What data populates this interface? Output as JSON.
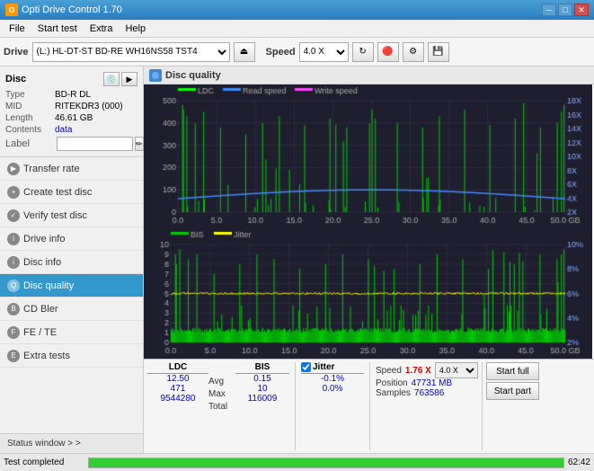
{
  "app": {
    "title": "Opti Drive Control 1.70",
    "icon": "O"
  },
  "titlebar": {
    "minimize": "─",
    "maximize": "□",
    "close": "✕"
  },
  "menubar": {
    "items": [
      "File",
      "Start test",
      "Extra",
      "Help"
    ]
  },
  "toolbar": {
    "drive_label": "Drive",
    "drive_value": "(L:)  HL-DT-ST BD-RE  WH16NS58 TST4",
    "speed_label": "Speed",
    "speed_value": "4.0 X"
  },
  "disc": {
    "title": "Disc",
    "type_label": "Type",
    "type_value": "BD-R DL",
    "mid_label": "MID",
    "mid_value": "RITEKDR3 (000)",
    "length_label": "Length",
    "length_value": "46.61 GB",
    "contents_label": "Contents",
    "contents_value": "data",
    "label_label": "Label",
    "label_value": ""
  },
  "nav": {
    "items": [
      {
        "id": "transfer-rate",
        "label": "Transfer rate",
        "active": false
      },
      {
        "id": "create-test-disc",
        "label": "Create test disc",
        "active": false
      },
      {
        "id": "verify-test-disc",
        "label": "Verify test disc",
        "active": false
      },
      {
        "id": "drive-info",
        "label": "Drive info",
        "active": false
      },
      {
        "id": "disc-info",
        "label": "Disc info",
        "active": false
      },
      {
        "id": "disc-quality",
        "label": "Disc quality",
        "active": true
      },
      {
        "id": "cd-bler",
        "label": "CD Bler",
        "active": false
      },
      {
        "id": "fe-te",
        "label": "FE / TE",
        "active": false
      },
      {
        "id": "extra-tests",
        "label": "Extra tests",
        "active": false
      }
    ]
  },
  "status_window": {
    "label": "Status window > >"
  },
  "panel": {
    "title": "Disc quality"
  },
  "chart_top": {
    "legend": {
      "ldc": "LDC",
      "read_speed": "Read speed",
      "write_speed": "Write speed"
    },
    "y_max": 500,
    "y_labels": [
      "500",
      "400",
      "300",
      "200",
      "100"
    ],
    "y2_labels": [
      "18X",
      "16X",
      "14X",
      "12X",
      "10X",
      "8X",
      "6X",
      "4X",
      "2X"
    ],
    "x_labels": [
      "0.0",
      "5.0",
      "10.0",
      "15.0",
      "20.0",
      "25.0",
      "30.0",
      "35.0",
      "40.0",
      "45.0",
      "50.0 GB"
    ]
  },
  "chart_bottom": {
    "legend": {
      "bis": "BIS",
      "jitter": "Jitter"
    },
    "y_labels": [
      "10",
      "9",
      "8",
      "7",
      "6",
      "5",
      "4",
      "3",
      "2",
      "1"
    ],
    "y2_labels": [
      "10%",
      "8%",
      "6%",
      "4%",
      "2%"
    ],
    "x_labels": [
      "0.0",
      "5.0",
      "10.0",
      "15.0",
      "20.0",
      "25.0",
      "30.0",
      "35.0",
      "40.0",
      "45.0",
      "50.0 GB"
    ]
  },
  "stats": {
    "headers": [
      "LDC",
      "BIS",
      "",
      "Jitter",
      "Speed",
      ""
    ],
    "rows": [
      {
        "label": "Avg",
        "ldc": "12.50",
        "bis": "0.15",
        "jitter": "-0.1%",
        "speed_label": "Position",
        "speed_value": "47731 MB"
      },
      {
        "label": "Max",
        "ldc": "471",
        "bis": "10",
        "jitter": "0.0%",
        "speed_label": "Samples",
        "speed_value": "763586"
      },
      {
        "label": "Total",
        "ldc": "9544280",
        "bis": "116009",
        "jitter": ""
      }
    ],
    "speed_current": "1.76 X",
    "speed_select": "4.0 X",
    "jitter_checked": true,
    "jitter_label": "Jitter"
  },
  "buttons": {
    "start_full": "Start full",
    "start_part": "Start part"
  },
  "bottom": {
    "status": "Test completed",
    "progress": 100,
    "time": "62:42"
  }
}
